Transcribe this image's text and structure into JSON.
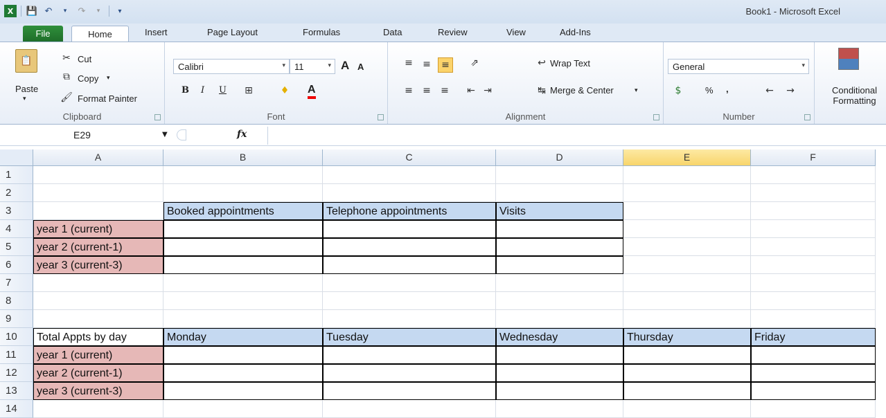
{
  "window": {
    "title": "Book1  -  Microsoft Excel"
  },
  "quick_access": {
    "save": "save-icon",
    "undo": "undo-icon",
    "redo": "redo-icon"
  },
  "tabs": [
    {
      "label": "File"
    },
    {
      "label": "Home"
    },
    {
      "label": "Insert"
    },
    {
      "label": "Page Layout"
    },
    {
      "label": "Formulas"
    },
    {
      "label": "Data"
    },
    {
      "label": "Review"
    },
    {
      "label": "View"
    },
    {
      "label": "Add-Ins"
    }
  ],
  "ribbon": {
    "clipboard": {
      "label": "Clipboard",
      "paste": "Paste",
      "cut": "Cut",
      "copy": "Copy",
      "format_painter": "Format Painter"
    },
    "font": {
      "label": "Font",
      "family": "Calibri",
      "size": "11",
      "bold": "B",
      "italic": "I",
      "underline": "U",
      "grow": "A",
      "shrink": "A",
      "font_color": "A"
    },
    "alignment": {
      "label": "Alignment",
      "wrap": "Wrap Text",
      "merge": "Merge & Center"
    },
    "number": {
      "label": "Number",
      "format": "General",
      "percent": "%",
      "comma": ","
    },
    "styles": {
      "conditional_formatting": "Conditional Formatting"
    }
  },
  "formula_bar": {
    "name_box": "E29",
    "fx": "fx",
    "value": ""
  },
  "grid": {
    "columns": [
      "A",
      "B",
      "C",
      "D",
      "E",
      "F"
    ],
    "selected_column": "E",
    "rows": [
      "1",
      "2",
      "3",
      "4",
      "5",
      "6",
      "7",
      "8",
      "9",
      "10",
      "11",
      "12",
      "13",
      "14"
    ],
    "cells": {
      "B3": "Booked appointments",
      "C3": "Telephone appointments",
      "D3": "Visits",
      "A4": "year 1 (current)",
      "A5": "year 2 (current-1)",
      "A6": "year 3 (current-3)",
      "A10": "Total Appts by day",
      "B10": "Monday",
      "C10": "Tuesday",
      "D10": "Wednesday",
      "E10": "Thursday",
      "F10": "Friday",
      "A11": "year 1 (current)",
      "A12": "year 2 (current-1)",
      "A13": "year 3 (current-3)"
    },
    "colors": {
      "label_fill": "#e6b8b7",
      "header_fill": "#c5d9f1",
      "selected_header": "#f8d56b"
    }
  }
}
